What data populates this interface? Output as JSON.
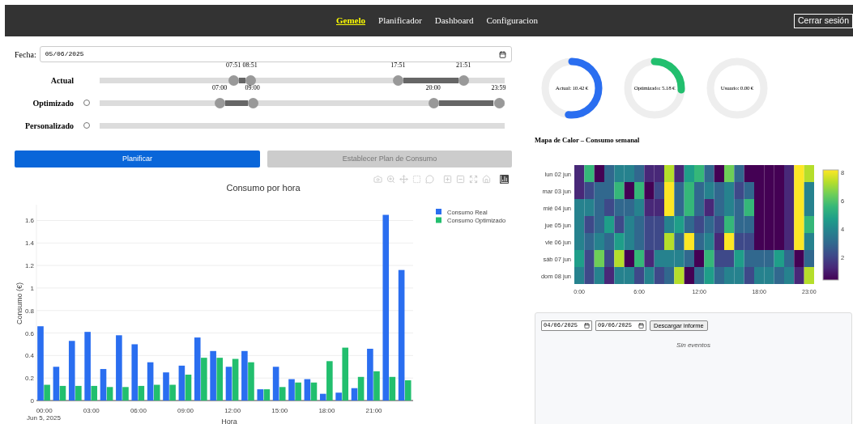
{
  "nav": {
    "items": [
      {
        "label": "Gemelo",
        "selected": true
      },
      {
        "label": "Planificador",
        "selected": false
      },
      {
        "label": "Dashboard",
        "selected": false
      },
      {
        "label": "Configuracion",
        "selected": false
      }
    ],
    "logout": "Cerrar sesión"
  },
  "date": {
    "label": "Fecha:",
    "value": "05/06/2025"
  },
  "schedules": [
    {
      "label": "Actual",
      "kind": "plain",
      "ranges": [
        {
          "from": {
            "label": "07:51",
            "level": 0.327
          },
          "to": {
            "label": "08:51",
            "level": 0.369
          }
        },
        {
          "from": {
            "label": "17:51",
            "level": 0.744
          },
          "to": {
            "label": "21:51",
            "level": 0.91
          }
        }
      ]
    },
    {
      "label": "Optimizado",
      "kind": "radio",
      "selected": false,
      "ranges": [
        {
          "from": {
            "label": "07:00",
            "level": 0.292
          },
          "to": {
            "label": "09:00",
            "level": 0.375
          }
        },
        {
          "from": {
            "label": "20:00",
            "level": 0.833
          },
          "to": {
            "label": "23:59",
            "level": 0.999
          }
        }
      ]
    },
    {
      "label": "Personalizado",
      "kind": "radio",
      "selected": false
    }
  ],
  "buttons": [
    {
      "label": "Planificar",
      "disabled": false
    },
    {
      "label": "Establecer Plan de Consumo",
      "disabled": true
    }
  ],
  "consumption_chart": {
    "chart_data": {
      "type": "bar",
      "title": "Consumo por hora",
      "xlabel": "Hora",
      "ylabel": "Consumo (€)",
      "x": [
        0,
        1,
        2,
        3,
        4,
        5,
        6,
        7,
        8,
        9,
        10,
        11,
        12,
        13,
        14,
        15,
        16,
        17,
        18,
        19,
        20,
        21,
        22,
        23
      ],
      "series": [
        {
          "name": "Consumo Real",
          "color": "#2a6ef0",
          "values": [
            0.66,
            0.3,
            0.53,
            0.61,
            0.28,
            0.58,
            0.5,
            0.34,
            0.25,
            0.31,
            0.56,
            0.44,
            0.3,
            0.44,
            0.1,
            0.3,
            0.19,
            0.19,
            0.06,
            0.07,
            0.11,
            0.46,
            1.65,
            1.16
          ]
        },
        {
          "name": "Consumo Optimizado",
          "color": "#22bf6e",
          "values": [
            0.14,
            0.13,
            0.13,
            0.13,
            0.12,
            0.12,
            0.13,
            0.14,
            0.14,
            0.23,
            0.38,
            0.38,
            0.37,
            0.34,
            0.1,
            0.12,
            0.16,
            0.16,
            0.35,
            0.47,
            0.21,
            0.26,
            0.21,
            0.18
          ]
        }
      ],
      "yticks": [
        0,
        0.2,
        0.4,
        0.6,
        0.8,
        1,
        1.2,
        1.4,
        1.6
      ],
      "xticks": [
        {
          "value": 0,
          "label": "00:00"
        },
        {
          "value": 3,
          "label": "03:00"
        },
        {
          "value": 6,
          "label": "06:00"
        },
        {
          "value": 9,
          "label": "09:00"
        },
        {
          "value": 12,
          "label": "12:00"
        },
        {
          "value": 15,
          "label": "15:00"
        },
        {
          "value": 18,
          "label": "18:00"
        },
        {
          "value": 21,
          "label": "21:00"
        }
      ],
      "xlim": [
        -0.5,
        23.5
      ],
      "ylim": [
        0,
        1.74
      ],
      "grid": true,
      "legend": true,
      "annotations": [
        {
          "text": "Jun 5, 2025"
        }
      ]
    }
  },
  "gauges": [
    {
      "label": "Actual: 10.42 €",
      "color": "#2a6ef0"
    },
    {
      "label": "Optimizado: 5.18 €",
      "color": "#22bf6e"
    },
    {
      "label": "Usuario: 0.00 €"
    }
  ],
  "heatmap": {
    "title": "Mapa de Calor – Consumo semanal",
    "rows": [
      {
        "label": "lun 02 jun",
        "cells": [
          {
            "color": "#482878"
          },
          {
            "color": "#35b779"
          },
          {
            "color": "#440154"
          },
          {
            "color": "#31688e"
          },
          {
            "color": "#26828e"
          },
          {
            "color": "#26828e"
          },
          {
            "color": "#31688e"
          },
          {
            "color": "#482878"
          },
          {
            "color": "#482878"
          },
          {
            "color": "#b5de2b"
          },
          {
            "color": "#482878"
          },
          {
            "color": "#1f9e89"
          },
          {
            "color": "#35b779"
          },
          {
            "color": "#31688e"
          },
          {
            "color": "#440154"
          },
          {
            "color": "#6ece58"
          },
          {
            "color": "#31688e"
          },
          {
            "color": "#440154"
          },
          {
            "color": "#440154"
          },
          {
            "color": "#440154"
          },
          {
            "color": "#440154"
          },
          {
            "color": "#482878"
          },
          {
            "color": "#fde725"
          },
          {
            "color": "#b5de2b"
          }
        ]
      },
      {
        "label": "mar 03 jun",
        "cells": [
          {
            "color": "#482878"
          },
          {
            "color": "#3e4989"
          },
          {
            "color": "#31688e"
          },
          {
            "color": "#31688e"
          },
          {
            "color": "#35b779"
          },
          {
            "color": "#440154"
          },
          {
            "color": "#35b779"
          },
          {
            "color": "#440154"
          },
          {
            "color": "#3e4989"
          },
          {
            "color": "#fde725"
          },
          {
            "color": "#31688e"
          },
          {
            "color": "#35b779"
          },
          {
            "color": "#31688e"
          },
          {
            "color": "#26828e"
          },
          {
            "color": "#31688e"
          },
          {
            "color": "#26828e"
          },
          {
            "color": "#3e4989"
          },
          {
            "color": "#31688e"
          },
          {
            "color": "#440154"
          },
          {
            "color": "#440154"
          },
          {
            "color": "#440154"
          },
          {
            "color": "#482878"
          },
          {
            "color": "#fde725"
          },
          {
            "color": "#26828e"
          }
        ]
      },
      {
        "label": "mié 04 jun",
        "cells": [
          {
            "color": "#26828e"
          },
          {
            "color": "#26828e"
          },
          {
            "color": "#31688e"
          },
          {
            "color": "#3e4989"
          },
          {
            "color": "#31688e"
          },
          {
            "color": "#31688e"
          },
          {
            "color": "#26828e"
          },
          {
            "color": "#482878"
          },
          {
            "color": "#482878"
          },
          {
            "color": "#fde725"
          },
          {
            "color": "#31688e"
          },
          {
            "color": "#35b779"
          },
          {
            "color": "#31688e"
          },
          {
            "color": "#482878"
          },
          {
            "color": "#31688e"
          },
          {
            "color": "#26828e"
          },
          {
            "color": "#31688e"
          },
          {
            "color": "#35b779"
          },
          {
            "color": "#440154"
          },
          {
            "color": "#440154"
          },
          {
            "color": "#440154"
          },
          {
            "color": "#482878"
          },
          {
            "color": "#fde725"
          },
          {
            "color": "#26828e"
          }
        ]
      },
      {
        "label": "jue 05 jun",
        "cells": [
          {
            "color": "#26828e"
          },
          {
            "color": "#3e4989"
          },
          {
            "color": "#31688e"
          },
          {
            "color": "#1f9e89"
          },
          {
            "color": "#3e4989"
          },
          {
            "color": "#26828e"
          },
          {
            "color": "#31688e"
          },
          {
            "color": "#3e4989"
          },
          {
            "color": "#3e4989"
          },
          {
            "color": "#26828e"
          },
          {
            "color": "#1f9e89"
          },
          {
            "color": "#31688e"
          },
          {
            "color": "#3e4989"
          },
          {
            "color": "#31688e"
          },
          {
            "color": "#3e4989"
          },
          {
            "color": "#35b779"
          },
          {
            "color": "#31688e"
          },
          {
            "color": "#31688e"
          },
          {
            "color": "#440154"
          },
          {
            "color": "#440154"
          },
          {
            "color": "#440154"
          },
          {
            "color": "#482878"
          },
          {
            "color": "#fde725"
          },
          {
            "color": "#35b779"
          }
        ]
      },
      {
        "label": "vie 06 jun",
        "cells": [
          {
            "color": "#26828e"
          },
          {
            "color": "#31688e"
          },
          {
            "color": "#26828e"
          },
          {
            "color": "#31688e"
          },
          {
            "color": "#1f9e89"
          },
          {
            "color": "#26828e"
          },
          {
            "color": "#31688e"
          },
          {
            "color": "#3e4989"
          },
          {
            "color": "#3e4989"
          },
          {
            "color": "#b5de2b"
          },
          {
            "color": "#31688e"
          },
          {
            "color": "#fde725"
          },
          {
            "color": "#31688e"
          },
          {
            "color": "#26828e"
          },
          {
            "color": "#482878"
          },
          {
            "color": "#fde725"
          },
          {
            "color": "#3e4989"
          },
          {
            "color": "#3e4989"
          },
          {
            "color": "#440154"
          },
          {
            "color": "#440154"
          },
          {
            "color": "#440154"
          },
          {
            "color": "#482878"
          },
          {
            "color": "#fde725"
          },
          {
            "color": "#26828e"
          }
        ]
      },
      {
        "label": "sáb 07 jun",
        "cells": [
          {
            "color": "#1f9e89"
          },
          {
            "color": "#3e4989"
          },
          {
            "color": "#6ece58"
          },
          {
            "color": "#3e4989"
          },
          {
            "color": "#b5de2b"
          },
          {
            "color": "#440154"
          },
          {
            "color": "#35b779"
          },
          {
            "color": "#482878"
          },
          {
            "color": "#26828e"
          },
          {
            "color": "#26828e"
          },
          {
            "color": "#26828e"
          },
          {
            "color": "#31688e"
          },
          {
            "color": "#440154"
          },
          {
            "color": "#35b779"
          },
          {
            "color": "#3e4989"
          },
          {
            "color": "#3e4989"
          },
          {
            "color": "#1f9e89"
          },
          {
            "color": "#31688e"
          },
          {
            "color": "#31688e"
          },
          {
            "color": "#31688e"
          },
          {
            "color": "#1f9e89"
          },
          {
            "color": "#31688e"
          },
          {
            "color": "#440154"
          },
          {
            "color": "#31688e"
          }
        ]
      },
      {
        "label": "dom 08 jun",
        "cells": [
          {
            "color": "#26828e"
          },
          {
            "color": "#3e4989"
          },
          {
            "color": "#26828e"
          },
          {
            "color": "#482878"
          },
          {
            "color": "#26828e"
          },
          {
            "color": "#26828e"
          },
          {
            "color": "#3e4989"
          },
          {
            "color": "#26828e"
          },
          {
            "color": "#3e4989"
          },
          {
            "color": "#31688e"
          },
          {
            "color": "#b5de2b"
          },
          {
            "color": "#440154"
          },
          {
            "color": "#31688e"
          },
          {
            "color": "#1f9e89"
          },
          {
            "color": "#31688e"
          },
          {
            "color": "#26828e"
          },
          {
            "color": "#26828e"
          },
          {
            "color": "#3e4989"
          },
          {
            "color": "#26828e"
          },
          {
            "color": "#26828e"
          },
          {
            "color": "#31688e"
          },
          {
            "color": "#26828e"
          },
          {
            "color": "#482878"
          },
          {
            "color": "#b5de2b"
          }
        ]
      }
    ],
    "x_labels": [
      "0:00",
      "6:00",
      "12:00",
      "18:00",
      "23:00"
    ],
    "scale_labels": [
      "8",
      "6",
      "4",
      "2"
    ]
  },
  "report": {
    "from": "04/06/2025",
    "to": "09/06/2025",
    "button": "Descargar informe",
    "empty": "Sin eventos"
  }
}
